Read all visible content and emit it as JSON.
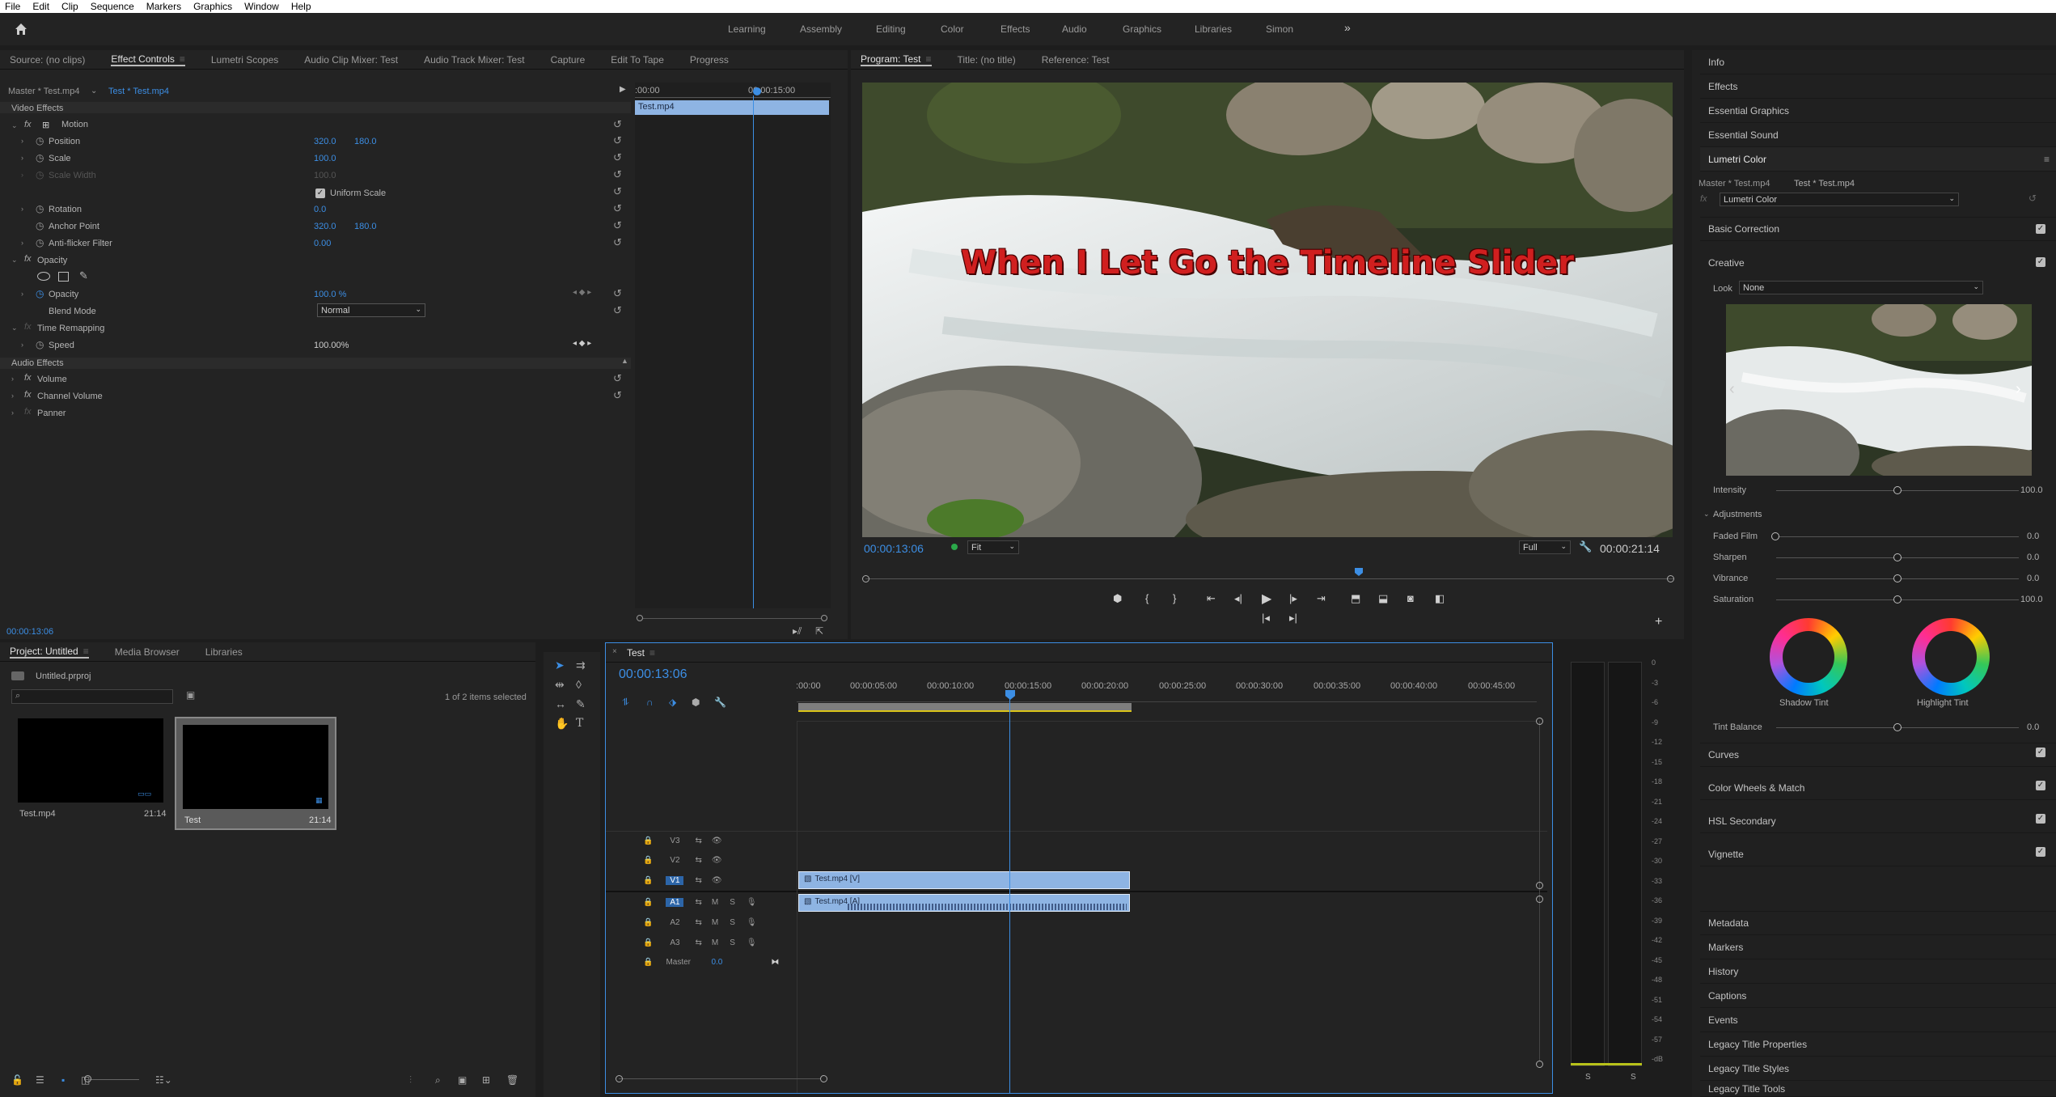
{
  "menubar": {
    "items": [
      "File",
      "Edit",
      "Clip",
      "Sequence",
      "Markers",
      "Graphics",
      "Window",
      "Help"
    ]
  },
  "workspaces": {
    "items": [
      "Learning",
      "Assembly",
      "Editing",
      "Color",
      "Effects",
      "Audio",
      "Graphics",
      "Libraries",
      "Simon"
    ],
    "more": "»"
  },
  "source_panel": {
    "tabs": [
      "Source: (no clips)",
      "Effect Controls",
      "Lumetri Scopes",
      "Audio Clip Mixer: Test",
      "Audio Track Mixer: Test",
      "Capture",
      "Edit To Tape",
      "Progress"
    ],
    "master_label": "Master * Test.mp4",
    "clip_label": "Test * Test.mp4",
    "mini_timecode_start": ":00:00",
    "mini_timecode_mid": "00:00:15:00",
    "mini_clip": "Test.mp4",
    "video_effects": "Video Effects",
    "motion": "Motion",
    "position_label": "Position",
    "position_x": "320.0",
    "position_y": "180.0",
    "scale_label": "Scale",
    "scale_val": "100.0",
    "scale_width_label": "Scale Width",
    "scale_width_val": "100.0",
    "uniform_scale": "Uniform Scale",
    "rotation_label": "Rotation",
    "rotation_val": "0.0",
    "anchor_label": "Anchor Point",
    "anchor_x": "320.0",
    "anchor_y": "180.0",
    "antiflicker_label": "Anti-flicker Filter",
    "antiflicker_val": "0.00",
    "opacity_group": "Opacity",
    "opacity_label": "Opacity",
    "opacity_val": "100.0 %",
    "blend_label": "Blend Mode",
    "blend_val": "Normal",
    "time_remap": "Time Remapping",
    "speed_label": "Speed",
    "speed_val": "100.00%",
    "audio_effects": "Audio Effects",
    "volume": "Volume",
    "channel_volume": "Channel Volume",
    "panner": "Panner",
    "bottom_timecode": "00:00:13:06",
    "fx": "fx"
  },
  "program": {
    "tabs": [
      "Program: Test",
      "Title: (no title)",
      "Reference: Test"
    ],
    "overlay_text": "When I Let Go the Timeline Slider",
    "timecode": "00:00:13:06",
    "fit": "Fit",
    "full": "Full",
    "duration": "00:00:21:14",
    "playhead_fraction": 0.61
  },
  "project": {
    "tabs": [
      "Project: Untitled",
      "Media Browser",
      "Libraries"
    ],
    "filename": "Untitled.prproj",
    "selected_count": "1 of 2 items selected",
    "items": [
      {
        "name": "Test.mp4",
        "duration": "21:14"
      },
      {
        "name": "Test",
        "duration": "21:14"
      }
    ]
  },
  "timeline": {
    "tab": "Test",
    "timecode": "00:00:13:06",
    "ruler": [
      ":00:00",
      "00:00:05:00",
      "00:00:10:00",
      "00:00:15:00",
      "00:00:20:00",
      "00:00:25:00",
      "00:00:30:00",
      "00:00:35:00",
      "00:00:40:00",
      "00:00:45:00"
    ],
    "video_tracks": [
      "V3",
      "V2",
      "V1"
    ],
    "audio_tracks": [
      "A1",
      "A2",
      "A3"
    ],
    "master": "Master",
    "master_val": "0.0",
    "mute": "M",
    "solo": "S",
    "video_clip": "Test.mp4 [V]",
    "audio_clip": "Test.mp4 [A]"
  },
  "meters": {
    "scale": [
      "0",
      "-3",
      "-6",
      "-9",
      "-12",
      "-15",
      "-18",
      "-21",
      "-24",
      "-27",
      "-30",
      "-33",
      "-36",
      "-39",
      "-42",
      "-45",
      "-48",
      "-51",
      "-54",
      "-57",
      "-dB"
    ],
    "solo_left": "S",
    "solo_right": "S"
  },
  "right_panels": {
    "top": [
      "Info",
      "Effects",
      "Essential Graphics",
      "Essential Sound",
      "Lumetri Color"
    ],
    "lumetri": {
      "master_label": "Master * Test.mp4",
      "clip_label": "Test * Test.mp4",
      "effect_select": "Lumetri Color",
      "basic_correction": "Basic Correction",
      "creative": "Creative",
      "look_label": "Look",
      "look_val": "None",
      "intensity_label": "Intensity",
      "intensity_val": "100.0",
      "adjustments": "Adjustments",
      "faded_film": "Faded Film",
      "faded_val": "0.0",
      "sharpen": "Sharpen",
      "sharpen_val": "0.0",
      "vibrance": "Vibrance",
      "vibrance_val": "0.0",
      "saturation": "Saturation",
      "saturation_val": "100.0",
      "shadow_tint": "Shadow Tint",
      "highlight_tint": "Highlight Tint",
      "tint_balance": "Tint Balance",
      "tint_balance_val": "0.0",
      "curves": "Curves",
      "wheels": "Color Wheels & Match",
      "hsl": "HSL Secondary",
      "vignette": "Vignette"
    },
    "bottom": [
      "Metadata",
      "Markers",
      "History",
      "Captions",
      "Events",
      "Legacy Title Properties",
      "Legacy Title Styles",
      "Legacy Title Tools"
    ]
  }
}
